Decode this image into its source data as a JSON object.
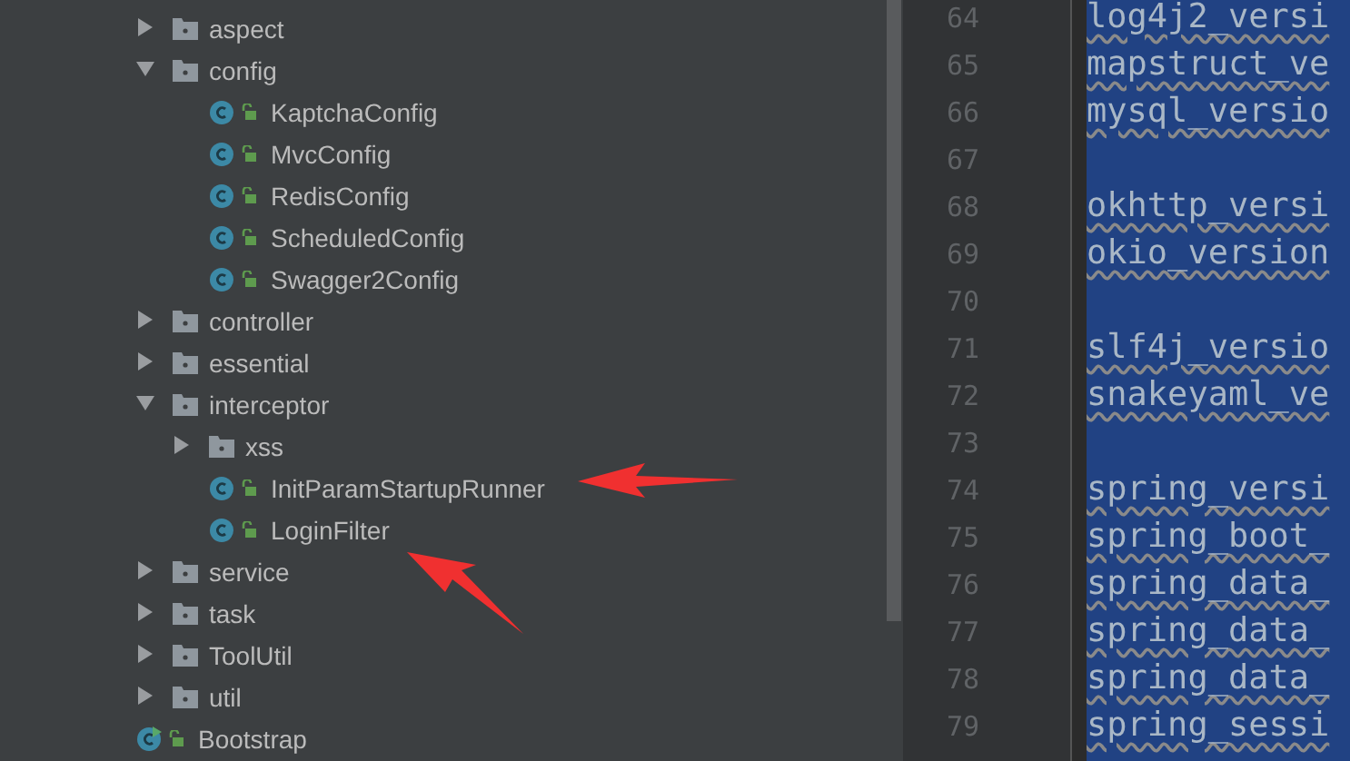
{
  "project_tree": [
    {
      "kind": "folder",
      "label": "aspect",
      "expanded": false
    },
    {
      "kind": "folder",
      "label": "config",
      "expanded": true,
      "children": [
        {
          "kind": "class",
          "label": "KaptchaConfig"
        },
        {
          "kind": "class",
          "label": "MvcConfig"
        },
        {
          "kind": "class",
          "label": "RedisConfig"
        },
        {
          "kind": "class",
          "label": "ScheduledConfig"
        },
        {
          "kind": "class",
          "label": "Swagger2Config"
        }
      ]
    },
    {
      "kind": "folder",
      "label": "controller",
      "expanded": false
    },
    {
      "kind": "folder",
      "label": "essential",
      "expanded": false
    },
    {
      "kind": "folder",
      "label": "interceptor",
      "expanded": true,
      "children": [
        {
          "kind": "folder",
          "label": "xss",
          "expanded": false
        },
        {
          "kind": "class",
          "label": "InitParamStartupRunner"
        },
        {
          "kind": "class",
          "label": "LoginFilter"
        }
      ]
    },
    {
      "kind": "folder",
      "label": "service",
      "expanded": false
    },
    {
      "kind": "folder",
      "label": "task",
      "expanded": false
    },
    {
      "kind": "folder",
      "label": "ToolUtil",
      "expanded": false
    },
    {
      "kind": "folder",
      "label": "util",
      "expanded": false
    },
    {
      "kind": "main_class",
      "label": "Bootstrap"
    }
  ],
  "editor_lines": [
    {
      "number": "64",
      "code": "log4j2_versi"
    },
    {
      "number": "65",
      "code": "mapstruct_ve"
    },
    {
      "number": "66",
      "code": "mysql_versio"
    },
    {
      "number": "67"
    },
    {
      "number": "68",
      "code": "okhttp_versi"
    },
    {
      "number": "69",
      "code": "okio_version"
    },
    {
      "number": "70"
    },
    {
      "number": "71",
      "code": "slf4j_versio"
    },
    {
      "number": "72",
      "code": "snakeyaml_ve"
    },
    {
      "number": "73"
    },
    {
      "number": "74",
      "code": "spring_versi"
    },
    {
      "number": "75",
      "code": "spring_boot_"
    },
    {
      "number": "76",
      "code": "spring_data_"
    },
    {
      "number": "77",
      "code": "spring_data_"
    },
    {
      "number": "78",
      "code": "spring_data_"
    },
    {
      "number": "79",
      "code": "spring_sessi"
    }
  ]
}
